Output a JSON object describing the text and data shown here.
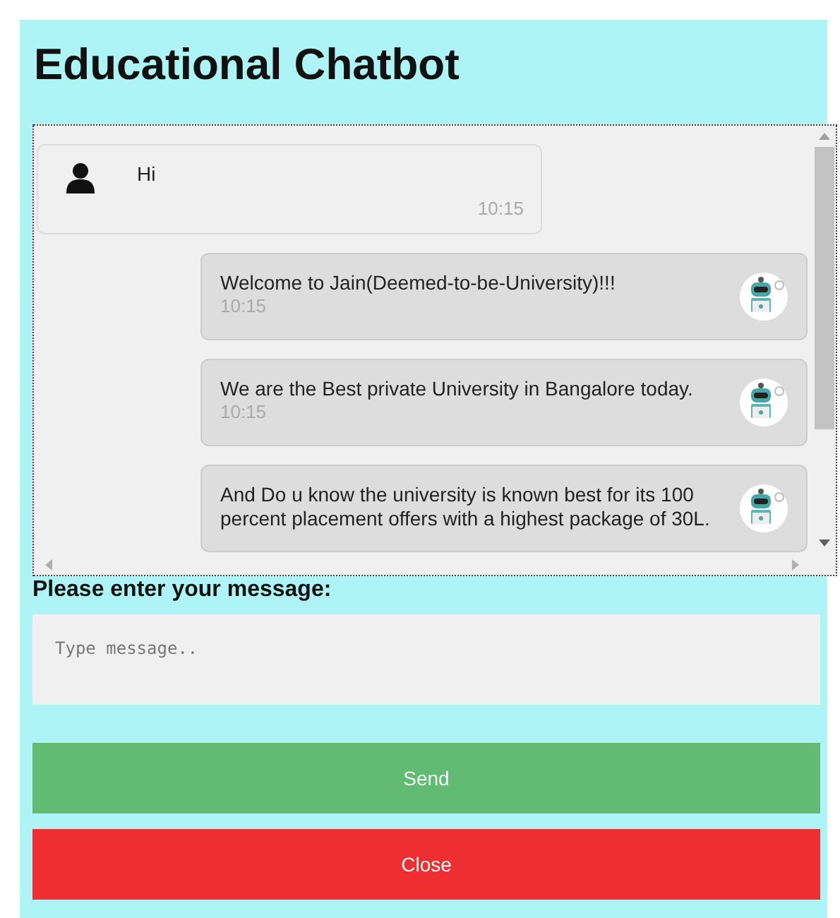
{
  "title": "Educational Chatbot",
  "messages": [
    {
      "kind": "user",
      "text": "Hi",
      "time": "10:15"
    },
    {
      "kind": "bot",
      "text": "Welcome to Jain(Deemed-to-be-University)!!!",
      "time": "10:15"
    },
    {
      "kind": "bot",
      "text": "We are the Best private University in Bangalore today.",
      "time": "10:15"
    },
    {
      "kind": "bot",
      "text": "And Do u know the university is known best for its 100 percent placement offers with a highest package of 30L."
    }
  ],
  "prompt": "Please enter your message:",
  "input": {
    "placeholder": "Type message.."
  },
  "buttons": [
    {
      "kind": "send",
      "label": "Send"
    },
    {
      "kind": "close",
      "label": "Close"
    }
  ]
}
